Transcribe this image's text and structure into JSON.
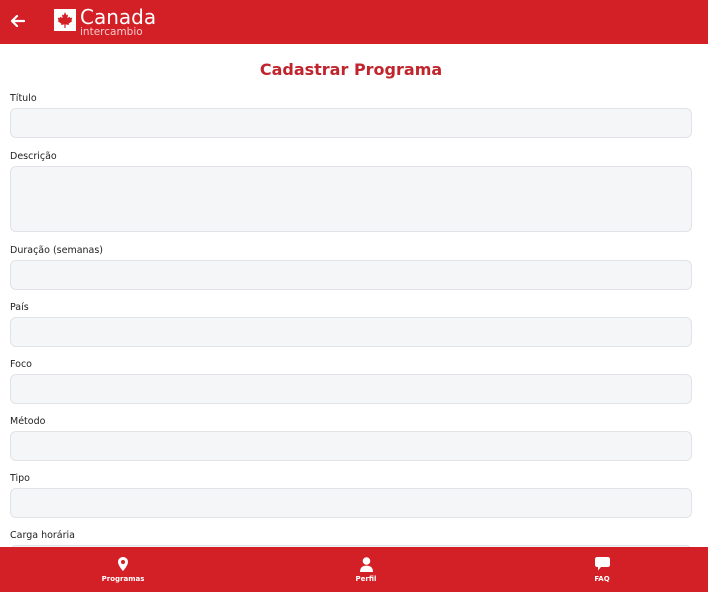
{
  "header": {
    "back_icon": "arrow-left-icon",
    "logo_name": "Canada",
    "logo_sub": "intercambio",
    "logo_icon": "maple-leaf-icon"
  },
  "form": {
    "title": "Cadastrar Programa",
    "fields": [
      {
        "label": "Título",
        "value": ""
      },
      {
        "label": "Descrição",
        "value": ""
      },
      {
        "label": "Duração (semanas)",
        "value": ""
      },
      {
        "label": "País",
        "value": ""
      },
      {
        "label": "Foco",
        "value": ""
      },
      {
        "label": "Método",
        "value": ""
      },
      {
        "label": "Tipo",
        "value": ""
      },
      {
        "label": "Carga horária",
        "value": ""
      }
    ]
  },
  "nav": {
    "items": [
      {
        "label": "Programas",
        "icon": "map-pin-icon"
      },
      {
        "label": "Perfil",
        "icon": "user-icon"
      },
      {
        "label": "FAQ",
        "icon": "chat-bubble-icon"
      }
    ]
  },
  "colors": {
    "brand_red": "#d32027",
    "title_red": "#c0242c",
    "input_bg": "#f5f6f8",
    "input_border": "#e1e3e7"
  }
}
